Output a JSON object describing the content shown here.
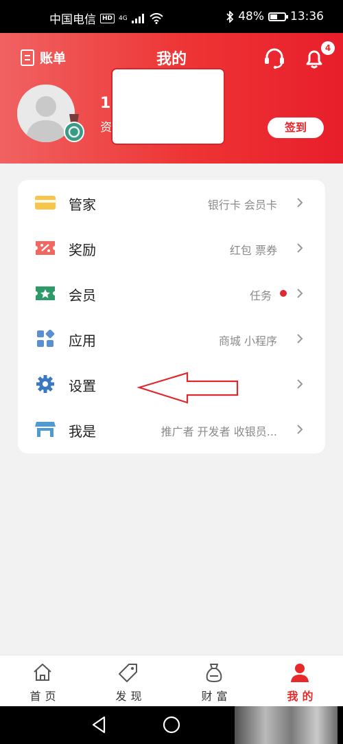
{
  "status_bar": {
    "carrier": "中国电信",
    "hd": "HD",
    "network": "4G",
    "battery": "48%",
    "time": "13:36"
  },
  "header": {
    "bill_label": "账单",
    "title": "我的",
    "notification_count": "4",
    "user_name": "1",
    "user_sub": "资",
    "signin_label": "签到"
  },
  "menu": [
    {
      "label": "管家",
      "value": "银行卡 会员卡",
      "icon": "card-icon"
    },
    {
      "label": "奖励",
      "value": "红包 票券",
      "icon": "coupon-icon"
    },
    {
      "label": "会员",
      "value": "任务",
      "icon": "member-ticket-icon",
      "dot": true
    },
    {
      "label": "应用",
      "value": "商城 小程序",
      "icon": "apps-grid-icon"
    },
    {
      "label": "设置",
      "value": "",
      "icon": "gear-icon"
    },
    {
      "label": "我是",
      "value": "推广者 开发者 收银员...",
      "icon": "store-icon"
    }
  ],
  "tabs": [
    {
      "label": "首页",
      "icon": "home-icon"
    },
    {
      "label": "发现",
      "icon": "tag-icon"
    },
    {
      "label": "财富",
      "icon": "money-bag-icon"
    },
    {
      "label": "我的",
      "icon": "person-icon",
      "active": true
    }
  ],
  "colors": {
    "brand_red": "#e82a2a",
    "background": "#f2f2f2",
    "card": "#ffffff",
    "muted_text": "#8a8a8a"
  }
}
